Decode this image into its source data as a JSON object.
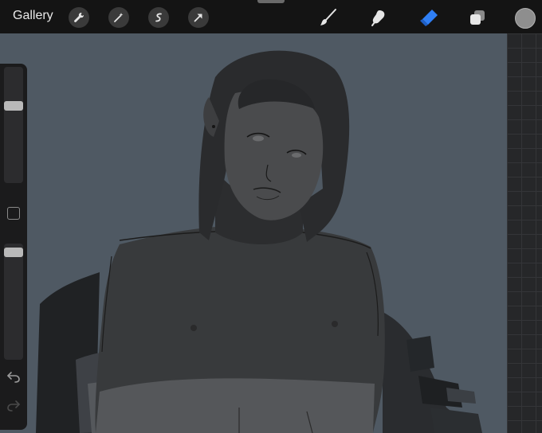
{
  "toolbar": {
    "gallery_label": "Gallery",
    "left_tools": [
      "wrench-icon",
      "magic-wand-icon",
      "selection-icon",
      "transform-arrow-icon"
    ],
    "right_tools": [
      "brush-icon",
      "smudge-icon",
      "eraser-icon",
      "layers-icon"
    ],
    "active_tool": "eraser-icon",
    "accent_color": "#2f7ff5",
    "current_color": "#8e8e8e"
  },
  "sidebar": {
    "brush_size_level": 0.32,
    "opacity_level": 0.04,
    "undo_icon": "undo-icon",
    "redo_icon": "redo-icon"
  },
  "canvas": {
    "background_color": "#4f5963"
  }
}
